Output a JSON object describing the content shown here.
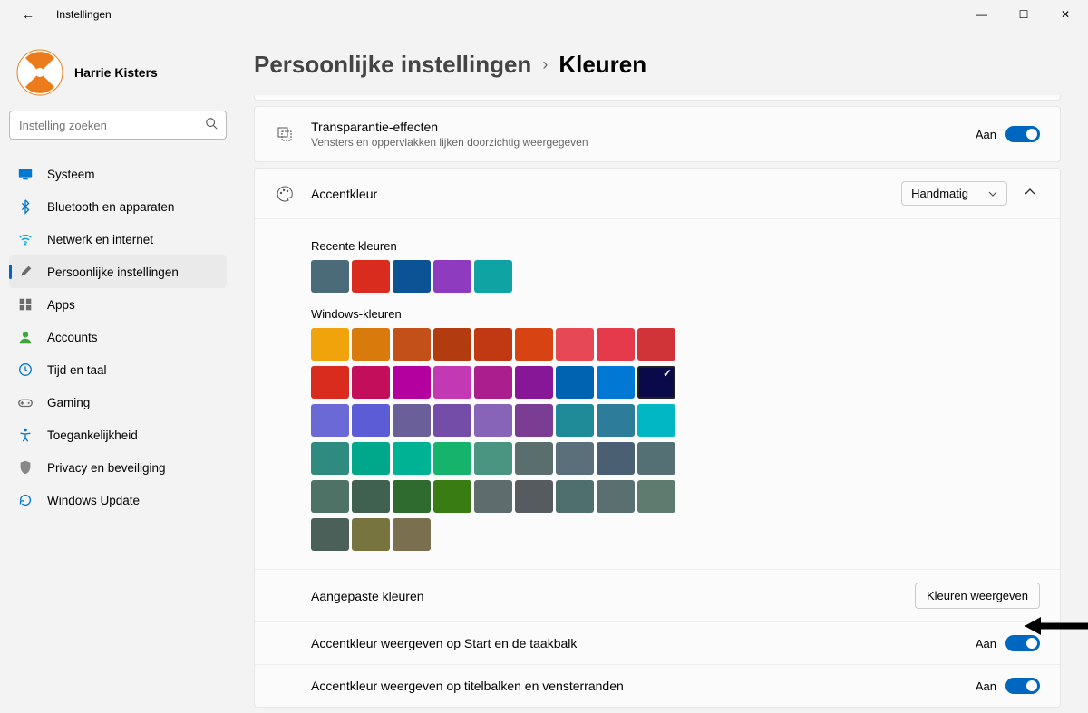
{
  "window": {
    "title": "Instellingen"
  },
  "user": {
    "name": "Harrie Kisters"
  },
  "search": {
    "placeholder": "Instelling zoeken"
  },
  "nav": {
    "items": [
      {
        "label": "Systeem",
        "icon": "display",
        "color": "#0078d4"
      },
      {
        "label": "Bluetooth en apparaten",
        "icon": "bluetooth",
        "color": "#0078d4"
      },
      {
        "label": "Netwerk en internet",
        "icon": "wifi",
        "color": "#00a2ed"
      },
      {
        "label": "Persoonlijke instellingen",
        "icon": "brush",
        "color": "#6b6b6b",
        "active": true
      },
      {
        "label": "Apps",
        "icon": "apps",
        "color": "#6b6b6b"
      },
      {
        "label": "Accounts",
        "icon": "account",
        "color": "#3ea33b"
      },
      {
        "label": "Tijd en taal",
        "icon": "clock",
        "color": "#0078d4"
      },
      {
        "label": "Gaming",
        "icon": "gaming",
        "color": "#6b6b6b"
      },
      {
        "label": "Toegankelijkheid",
        "icon": "accessibility",
        "color": "#0078d4"
      },
      {
        "label": "Privacy en beveiliging",
        "icon": "shield",
        "color": "#888"
      },
      {
        "label": "Windows Update",
        "icon": "update",
        "color": "#0078d4"
      }
    ]
  },
  "breadcrumb": {
    "parent": "Persoonlijke instellingen",
    "current": "Kleuren"
  },
  "transparency": {
    "title": "Transparantie-effecten",
    "subtitle": "Vensters en oppervlakken lijken doorzichtig weergegeven",
    "state": "Aan"
  },
  "accent": {
    "title": "Accentkleur",
    "mode": "Handmatig",
    "recent_label": "Recente kleuren",
    "recent_colors": [
      "#4a6b77",
      "#d92c1f",
      "#0b5394",
      "#8e3bbf",
      "#0fa3a3"
    ],
    "windows_label": "Windows-kleuren",
    "windows_colors": [
      [
        "#f0a30a",
        "#d87b0c",
        "#c25018",
        "#b23c10",
        "#c03913",
        "#d84314",
        "#e74856",
        "#e5394c",
        "#d13438"
      ],
      [
        "#d92c1f",
        "#c30e5c",
        "#b4009e",
        "#c239b3",
        "#aa1e8e",
        "#881798",
        "#0063b1",
        "#0078d4",
        "#0a0a4a"
      ],
      [
        "#6b69d6",
        "#5b5cd6",
        "#6b5f9a",
        "#744da9",
        "#8764b8",
        "#7a3d93",
        "#1f8b99",
        "#2d7d9a",
        "#00b7c3"
      ],
      [
        "#2f8a7f",
        "#00a88b",
        "#00b294",
        "#15b36b",
        "#4a9482",
        "#5a6e6e",
        "#5b6f7a",
        "#4a5f72",
        "#547075"
      ],
      [
        "#4e7265",
        "#406050",
        "#2f6b2f",
        "#3a7c14",
        "#5e6c6e",
        "#555b5e",
        "#4f6e6e",
        "#5a7070",
        "#5f7a6e"
      ],
      [
        "#4b6058",
        "#777440",
        "#7a6f4f"
      ]
    ],
    "selected": [
      1,
      8
    ],
    "custom_label": "Aangepaste kleuren",
    "custom_button": "Kleuren weergeven",
    "start_taskbar": {
      "title": "Accentkleur weergeven op Start en de taakbalk",
      "state": "Aan"
    },
    "titlebars": {
      "title": "Accentkleur weergeven op titelbalken en vensterranden",
      "state": "Aan"
    }
  }
}
